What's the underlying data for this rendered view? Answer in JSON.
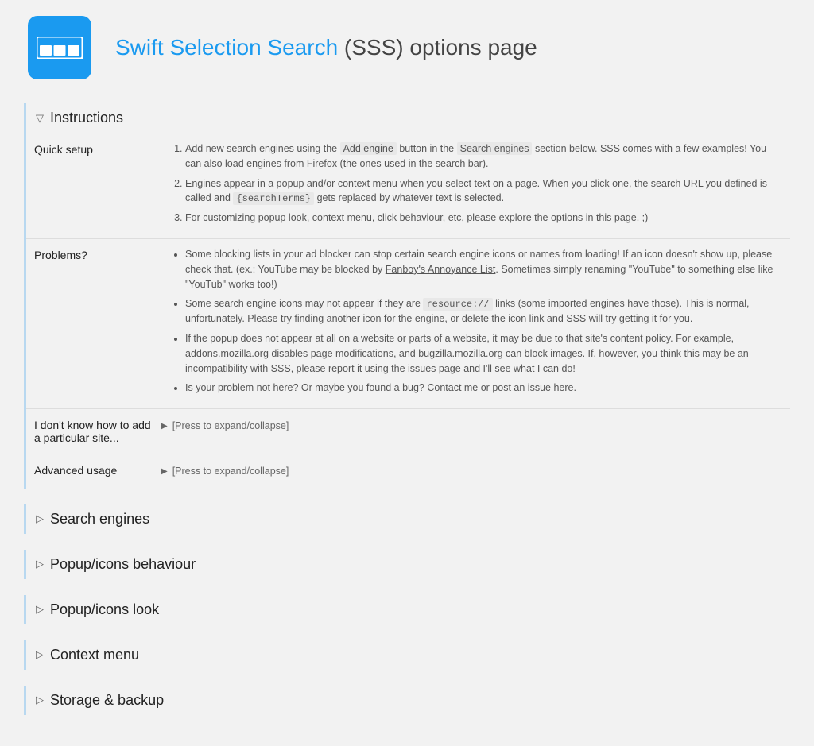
{
  "header": {
    "title_link": "Swift Selection Search",
    "title_suffix": " (SSS) options page"
  },
  "sections": {
    "instructions": {
      "title": "Instructions",
      "quick_setup": {
        "label": "Quick setup",
        "item1_a": "Add new search engines using the ",
        "item1_b": "Add engine",
        "item1_c": " button in the ",
        "item1_d": "Search engines",
        "item1_e": " section below. SSS comes with a few examples! You can also load engines from Firefox (the ones used in the search bar).",
        "item2_a": "Engines appear in a popup and/or context menu when you select text on a page. When you click one, the search URL you defined is called and ",
        "item2_b": "{searchTerms}",
        "item2_c": " gets replaced by whatever text is selected.",
        "item3": "For customizing popup look, context menu, click behaviour, etc, please explore the options in this page. ;)"
      },
      "problems": {
        "label": "Problems?",
        "item1_a": "Some blocking lists in your ad blocker can stop certain search engine icons or names from loading! If an icon doesn't show up, please check that. (ex.: YouTube may be blocked by ",
        "item1_b": "Fanboy's Annoyance List",
        "item1_c": ". Sometimes simply renaming \"YouTube\" to something else like \"YouTub\" works too!)",
        "item2_a": "Some search engine icons may not appear if they are ",
        "item2_b": "resource://",
        "item2_c": " links (some imported engines have those). This is normal, unfortunately. Please try finding another icon for the engine, or delete the icon link and SSS will try getting it for you.",
        "item3_a": "If the popup does not appear at all on a website or parts of a website, it may be due to that site's content policy. For example, ",
        "item3_b": "addons.mozilla.org",
        "item3_c": " disables page modifications, and ",
        "item3_d": "bugzilla.mozilla.org",
        "item3_e": " can block images. If, however, you think this may be an incompatibility with SSS, please report it using the ",
        "item3_f": "issues page",
        "item3_g": " and I'll see what I can do!",
        "item4_a": "Is your problem not here? Or maybe you found a bug? Contact me or post an issue ",
        "item4_b": "here",
        "item4_c": "."
      },
      "addsite": {
        "label": "I don't know how to add a particular site...",
        "expand_text": "[Press to expand/collapse]"
      },
      "advanced": {
        "label": "Advanced usage",
        "expand_text": "[Press to expand/collapse]"
      }
    },
    "search_engines": {
      "title": "Search engines"
    },
    "popup_behaviour": {
      "title": "Popup/icons behaviour"
    },
    "popup_look": {
      "title": "Popup/icons look"
    },
    "context_menu": {
      "title": "Context menu"
    },
    "storage": {
      "title": "Storage & backup"
    }
  }
}
